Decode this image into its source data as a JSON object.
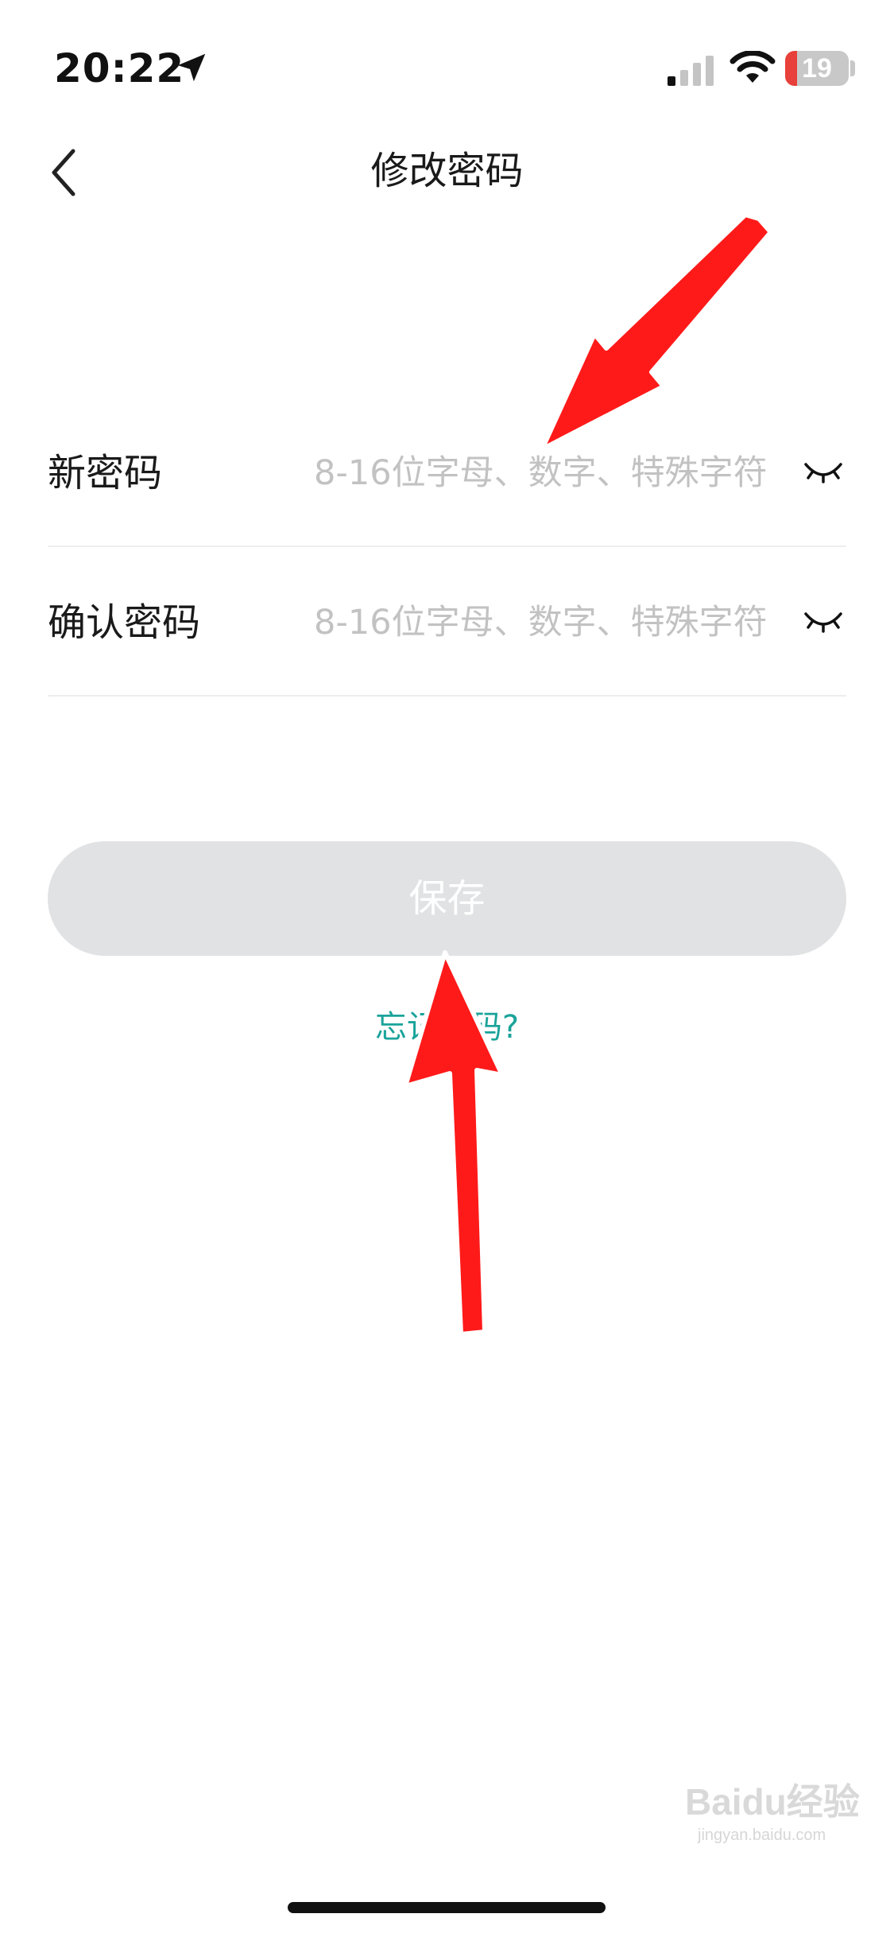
{
  "status_bar": {
    "time": "20:22",
    "location_icon": "location-arrow-icon",
    "signal_icon": "cellular-signal-icon",
    "wifi_icon": "wifi-icon",
    "battery_level": "19",
    "battery_fraction": 0.19,
    "battery_color": "#e8403a"
  },
  "nav": {
    "back_icon": "chevron-left-icon",
    "title": "修改密码"
  },
  "form": {
    "fields": [
      {
        "label": "新密码",
        "placeholder": "8-16位字母、数字、特殊字符",
        "icon": "eye-closed-icon"
      },
      {
        "label": "确认密码",
        "placeholder": "8-16位字母、数字、特殊字符",
        "icon": "eye-closed-icon"
      }
    ]
  },
  "actions": {
    "save_label": "保存",
    "forgot_label": "忘记密码?",
    "forgot_color": "#1aa39a",
    "save_bg_color": "#e1e2e4"
  },
  "annotations": {
    "arrow_color": "#ff1a1a"
  },
  "watermark": {
    "brand": "Baidu经验",
    "url": "jingyan.baidu.com"
  }
}
